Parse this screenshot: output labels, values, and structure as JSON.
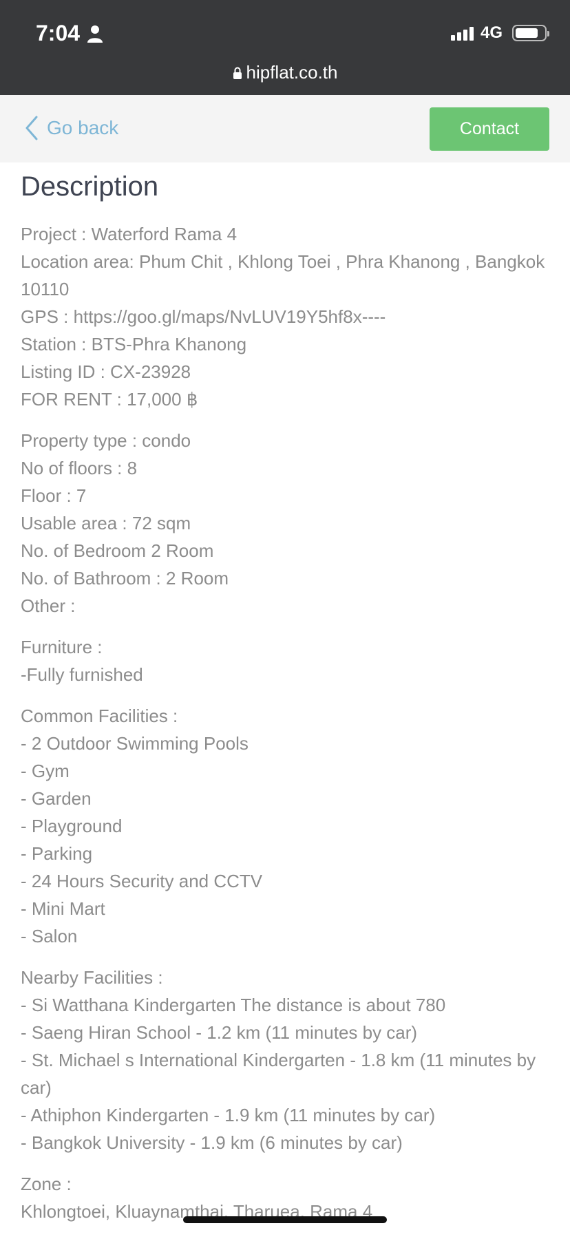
{
  "status_bar": {
    "time": "7:04",
    "network": "4G",
    "url": "hipflat.co.th",
    "icons": [
      "person-icon",
      "signal-icon",
      "battery-icon",
      "lock-icon"
    ]
  },
  "nav": {
    "back_label": "Go back",
    "contact_label": "Contact",
    "colors": {
      "back": "#7eb6d6",
      "contact_bg": "#6cc573"
    }
  },
  "description": {
    "title": "Description",
    "blocks": [
      [
        "Project : Waterford Rama 4",
        "Location area: Phum Chit , Khlong Toei , Phra Khanong , Bangkok 10110",
        "GPS : https://goo.gl/maps/NvLUV19Y5hf8x----",
        "Station : BTS-Phra Khanong",
        "Listing ID : CX-23928",
        "FOR RENT : 17,000 ฿"
      ],
      [
        "Property type : condo",
        "No of floors : 8",
        "Floor : 7",
        "Usable area : 72 sqm",
        "No. of Bedroom 2 Room",
        "No. of Bathroom : 2 Room",
        "Other :"
      ],
      [
        "Furniture :",
        "-Fully furnished"
      ],
      [
        "Common Facilities :",
        "- 2 Outdoor Swimming Pools",
        "- Gym",
        "- Garden",
        "- Playground",
        "- Parking",
        "- 24 Hours Security and CCTV",
        "- Mini Mart",
        "- Salon"
      ],
      [
        "Nearby Facilities :",
        "- Si Watthana Kindergarten The distance is about 780",
        "- Saeng Hiran School - 1.2 km (11 minutes by car)",
        "- St. Michael s International Kindergarten - 1.8 km (11 minutes by car)",
        "- Athiphon Kindergarten - 1.9 km (11 minutes by car)",
        "- Bangkok University - 1.9 km (6 minutes by car)"
      ],
      [
        "Zone :",
        "Khlongtoei, Kluaynamthai, Tharuea, Rama 4"
      ]
    ]
  }
}
